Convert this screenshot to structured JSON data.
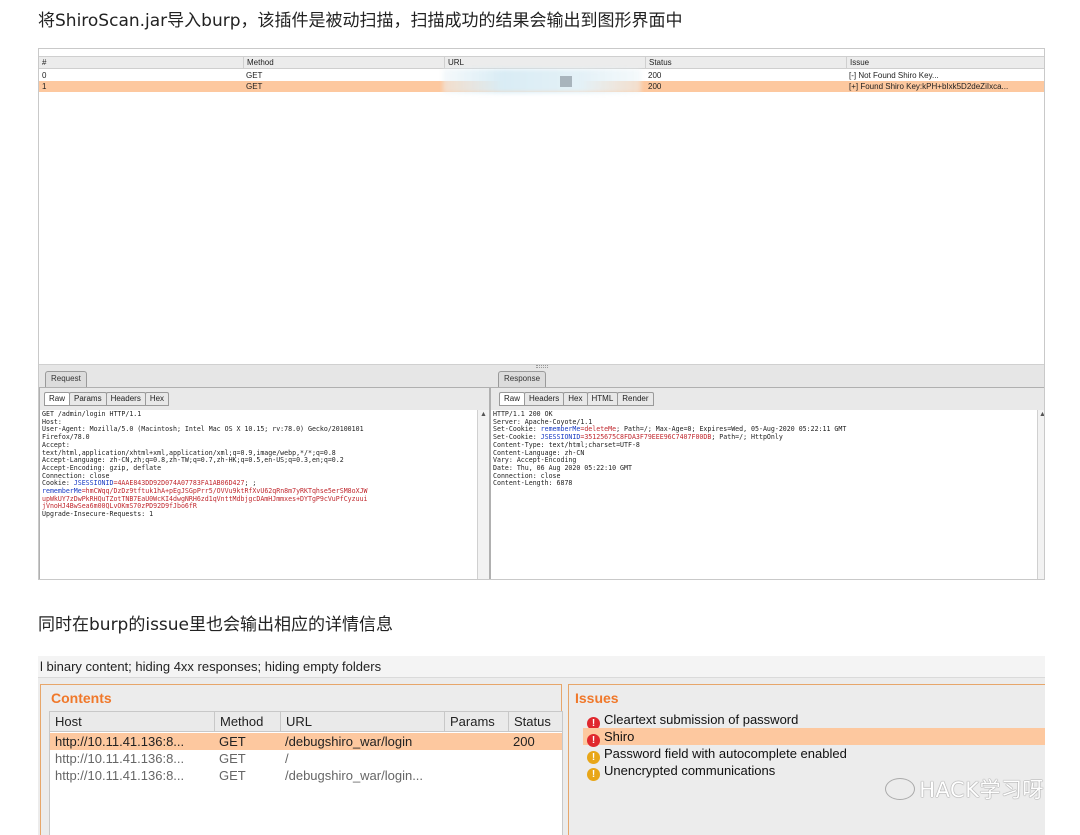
{
  "heading1": "将ShiroScan.jar导入burp，该插件是被动扫描，扫描成功的结果会输出到图形界面中",
  "heading2": "同时在burp的issue里也会输出相应的详情信息",
  "scan_table": {
    "columns": [
      "#",
      "Method",
      "URL",
      "Status",
      "Issue"
    ],
    "rows": [
      {
        "num": "0",
        "method": "GET",
        "url": "",
        "status": "200",
        "issue": "[-] Not Found Shiro Key..."
      },
      {
        "num": "1",
        "method": "GET",
        "url": "",
        "status": "200",
        "issue": "[+] Found Shiro Key:kPH+bIxk5D2deZiIxca..."
      }
    ]
  },
  "request_pane": {
    "title": "Request",
    "tabs": [
      "Raw",
      "Params",
      "Headers",
      "Hex"
    ],
    "lines": [
      "GET /admin/login HTTP/1.1",
      "Host:",
      "User-Agent: Mozilla/5.0 (Macintosh; Intel Mac OS X 10.15; rv:78.0) Gecko/20100101",
      "Firefox/78.0",
      "Accept:",
      "text/html,application/xhtml+xml,application/xml;q=0.9,image/webp,*/*;q=0.8",
      "Accept-Language: zh-CN,zh;q=0.8,zh-TW;q=0.7,zh-HK;q=0.5,en-US;q=0.3,en;q=0.2",
      "Accept-Encoding: gzip, deflate",
      "Connection: close"
    ],
    "cookie_prefix": "Cookie: ",
    "cookie_name": "JSESSIONID",
    "cookie_value": "=4AAE843DD92D074A07783FA1AB06D427",
    "cookie_suffix": "; ;",
    "remember_name": "rememberMe",
    "remember_value_1": "=hmCWqq/DzDz9tftuk1hA+pEgJSGpPrr5/OVVu9ktRfXvU62qRn8m7yRKTqhse5erSM8oXJW",
    "remember_value_2": "upWkUY7zDwPkRHQuTZotTNB7EaU0WcKI4dwgNRH6zd1qVnttMdbjgcDAmHJmmxes+DYTgP9cVuPfCyzuui",
    "remember_value_3": "jVnoHJ4BwSea6m00QLvOKmS70zPD92D9fJbo6fR",
    "last_line": "Upgrade-Insecure-Requests: 1"
  },
  "response_pane": {
    "title": "Response",
    "tabs": [
      "Raw",
      "Headers",
      "Hex",
      "HTML",
      "Render"
    ],
    "line1": "HTTP/1.1 200 OK",
    "line2": "Server: Apache-Coyote/1.1",
    "set_cookie_prefix": "Set-Cookie: ",
    "rm_name": "rememberMe",
    "rm_value": "=deleteMe",
    "rm_rest": "; Path=/; Max-Age=0; Expires=Wed, 05-Aug-2020 05:22:11 GMT",
    "js_name": "JSESSIONID",
    "js_value": "=35125675C8FDA3F79EEE96C7407F00DB",
    "js_rest": "; Path=/; HttpOnly",
    "lines_after": [
      "Content-Type: text/html;charset=UTF-8",
      "Content-Language: zh-CN",
      "Vary: Accept-Encoding",
      "Date: Thu, 06 Aug 2020 05:22:10 GMT",
      "Connection: close",
      "Content-Length: 6878"
    ]
  },
  "filter_text": "l binary content;  hiding 4xx responses;  hiding empty folders",
  "contents": {
    "title": "Contents",
    "columns": [
      "Host",
      "Method",
      "URL",
      "Params",
      "Status"
    ],
    "rows": [
      {
        "host": "http://10.11.41.136:8...",
        "method": "GET",
        "url": "/debugshiro_war/login",
        "params": "",
        "status": "200"
      },
      {
        "host": "http://10.11.41.136:8...",
        "method": "GET",
        "url": "/",
        "params": "",
        "status": ""
      },
      {
        "host": "http://10.11.41.136:8...",
        "method": "GET",
        "url": "/debugshiro_war/login...",
        "params": "",
        "status": ""
      }
    ]
  },
  "issues": {
    "title": "Issues",
    "items": [
      {
        "label": "Cleartext submission of password",
        "icon": "red-alert-icon"
      },
      {
        "label": "Shiro",
        "icon": "red-alert-icon"
      },
      {
        "label": "Password field with autocomplete enabled",
        "icon": "amber-alert-icon"
      },
      {
        "label": "Unencrypted communications",
        "icon": "amber-alert-icon"
      }
    ]
  },
  "watermark": "HACK学习呀",
  "colors": {
    "selection": "#fdc89f",
    "accent": "#f0782a",
    "red_icon": "#e0282e",
    "amber_icon": "#e8a618"
  }
}
